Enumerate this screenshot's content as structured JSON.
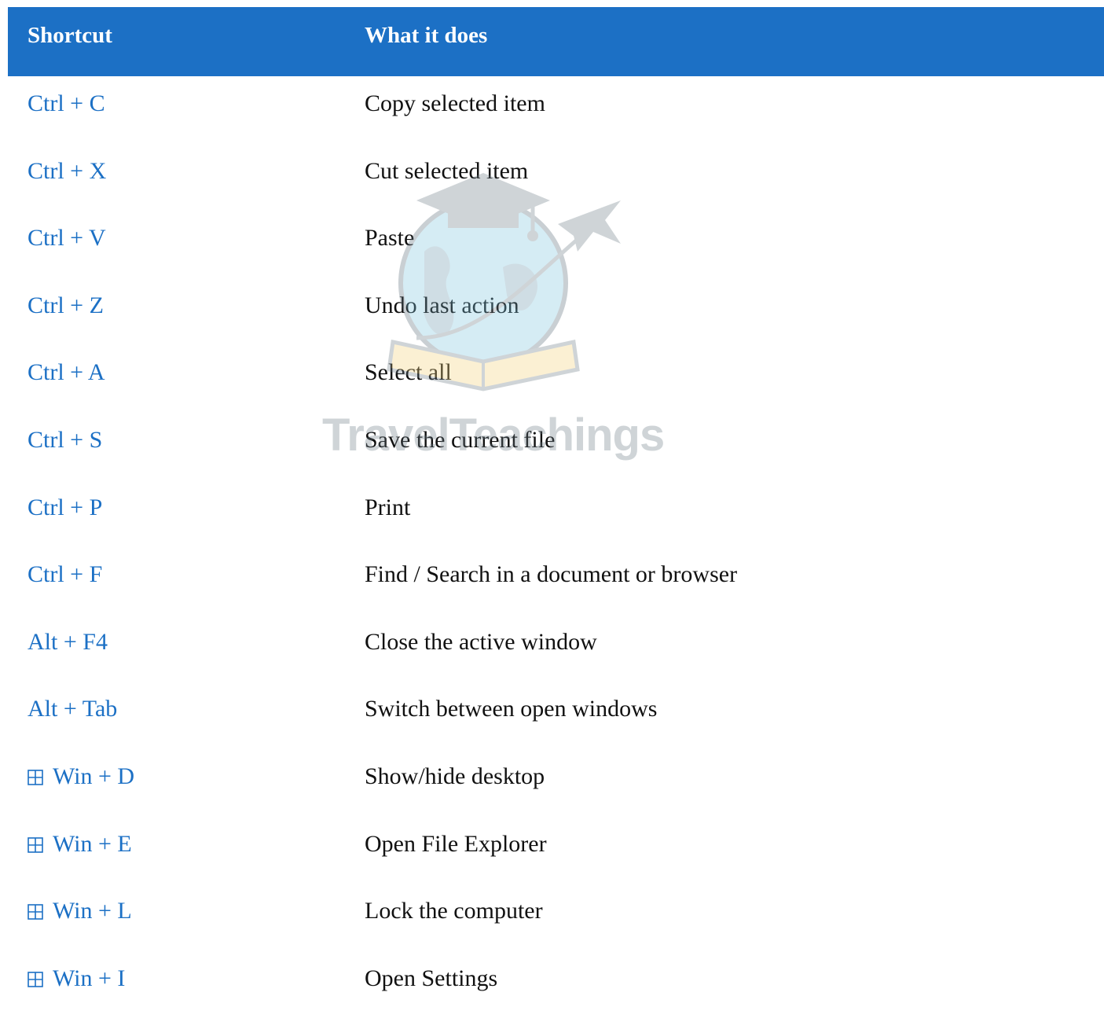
{
  "table": {
    "headers": {
      "shortcut": "Shortcut",
      "description": "What it does"
    },
    "rows": [
      {
        "shortcut": "Ctrl + C",
        "description": "Copy selected item",
        "win_icon": false
      },
      {
        "shortcut": "Ctrl + X",
        "description": "Cut selected item",
        "win_icon": false
      },
      {
        "shortcut": "Ctrl + V",
        "description": "Paste",
        "win_icon": false
      },
      {
        "shortcut": "Ctrl + Z",
        "description": "Undo last action",
        "win_icon": false
      },
      {
        "shortcut": "Ctrl + A",
        "description": "Select all",
        "win_icon": false
      },
      {
        "shortcut": "Ctrl + S",
        "description": "Save the current file",
        "win_icon": false
      },
      {
        "shortcut": "Ctrl + P",
        "description": "Print",
        "win_icon": false
      },
      {
        "shortcut": "Ctrl + F",
        "description": "Find / Search in a document or browser",
        "win_icon": false
      },
      {
        "shortcut": "Alt + F4",
        "description": "Close the active window",
        "win_icon": false
      },
      {
        "shortcut": "Alt + Tab",
        "description": "Switch between open windows",
        "win_icon": false
      },
      {
        "shortcut": "Win + D",
        "description": "Show/hide desktop",
        "win_icon": true
      },
      {
        "shortcut": "Win + E",
        "description": "Open File Explorer",
        "win_icon": true
      },
      {
        "shortcut": "Win + L",
        "description": "Lock the computer",
        "win_icon": true
      },
      {
        "shortcut": "Win + I",
        "description": "Open Settings",
        "win_icon": true
      }
    ]
  },
  "watermark": {
    "text": "TravelTeachings"
  },
  "colors": {
    "header_bg": "#1c70c5",
    "shortcut_text": "#1c70c5",
    "body_text": "#111111"
  },
  "icons": {
    "windows_key": "windows-icon"
  }
}
